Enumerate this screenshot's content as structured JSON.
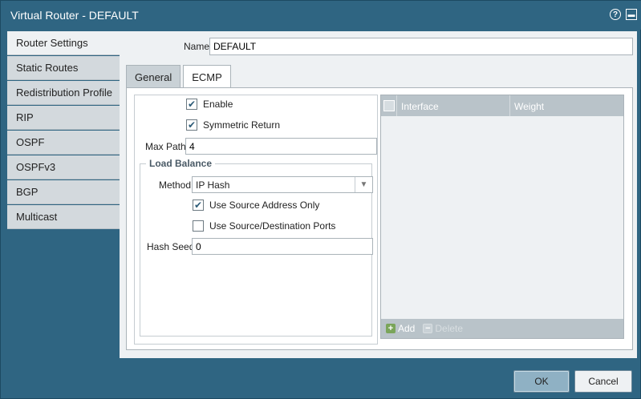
{
  "window": {
    "title": "Virtual Router - DEFAULT",
    "help_icon": "help-icon",
    "maximize_icon": "maximize-icon"
  },
  "sidebar": {
    "items": [
      {
        "label": "Router Settings",
        "active": true
      },
      {
        "label": "Static Routes"
      },
      {
        "label": "Redistribution Profile"
      },
      {
        "label": "RIP"
      },
      {
        "label": "OSPF"
      },
      {
        "label": "OSPFv3"
      },
      {
        "label": "BGP"
      },
      {
        "label": "Multicast"
      }
    ]
  },
  "name_field": {
    "label": "Name",
    "value": "DEFAULT"
  },
  "tabs": [
    {
      "label": "General"
    },
    {
      "label": "ECMP",
      "active": true
    }
  ],
  "ecmp": {
    "enable": {
      "label": "Enable",
      "checked": true
    },
    "symmetric_return": {
      "label": "Symmetric Return",
      "checked": true
    },
    "max_path": {
      "label": "Max Path",
      "value": "4"
    },
    "load_balance": {
      "title": "Load Balance",
      "method": {
        "label": "Method",
        "value": "IP Hash"
      },
      "use_source_address_only": {
        "label": "Use Source Address Only",
        "checked": true
      },
      "use_source_destination_ports": {
        "label": "Use Source/Destination Ports",
        "checked": false
      },
      "hash_seed": {
        "label": "Hash Seed",
        "value": "0"
      }
    }
  },
  "interface_grid": {
    "columns": [
      "Interface",
      "Weight"
    ],
    "rows": [],
    "add_label": "Add",
    "delete_label": "Delete"
  },
  "buttons": {
    "ok": "OK",
    "cancel": "Cancel"
  },
  "colors": {
    "background": "#2f6582",
    "accent_ok": "#8fb1c4",
    "grid_header": "#b9c3c9",
    "add_icon": "#7aa55a"
  }
}
